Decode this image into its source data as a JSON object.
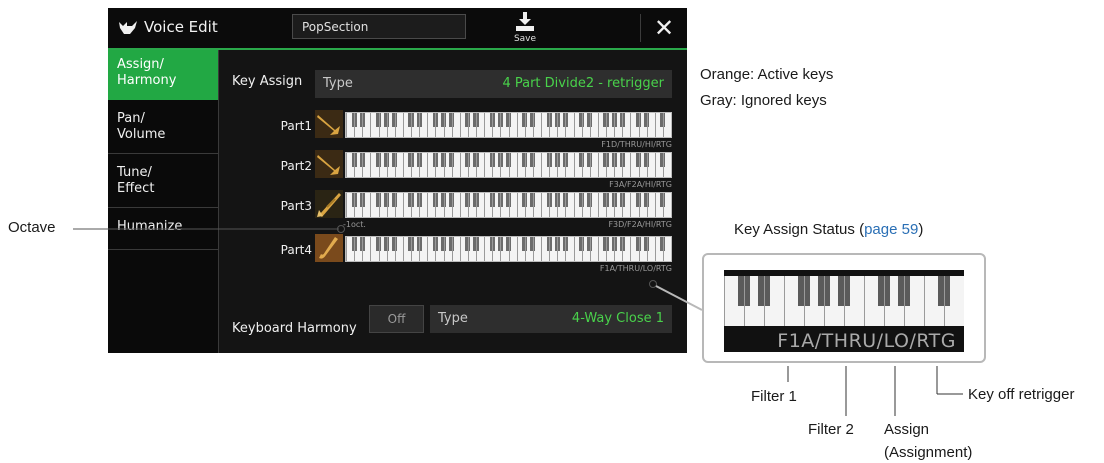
{
  "window": {
    "title": "Voice Edit",
    "app_icon": "voice-edit-icon",
    "voice_name": "PopSection",
    "save_label": "Save",
    "close_label": "✕"
  },
  "sidebar": {
    "items": [
      {
        "label": "Assign/\nHarmony",
        "active": true
      },
      {
        "label": "Pan/\nVolume",
        "active": false
      },
      {
        "label": "Tune/\nEffect",
        "active": false
      },
      {
        "label": "Humanize",
        "active": false
      }
    ]
  },
  "key_assign": {
    "label": "Key Assign",
    "type_label": "Type",
    "type_value": "4 Part Divide2 - retrigger"
  },
  "parts": [
    {
      "label": "Part1",
      "instrument_icon": "trumpet-icon",
      "status": "F1D/THRU/HI/RTG"
    },
    {
      "label": "Part2",
      "instrument_icon": "trumpet-icon",
      "status": "F3A/F2A/HI/RTG"
    },
    {
      "label": "Part3",
      "instrument_icon": "trombone-icon",
      "status": "F3D/F2A/HI/RTG",
      "octave": "-1oct."
    },
    {
      "label": "Part4",
      "instrument_icon": "saxophone-icon",
      "status": "F1A/THRU/LO/RTG"
    }
  ],
  "keyboard_harmony": {
    "label": "Keyboard Harmony",
    "toggle": "Off",
    "type_label": "Type",
    "type_value": "4-Way Close 1"
  },
  "annotations": {
    "legend_orange": "Orange: Active keys",
    "legend_gray": "Gray: Ignored keys",
    "octave": "Octave",
    "key_assign_status_title": "Key Assign Status (",
    "key_assign_status_link": "page 59",
    "key_assign_status_close": ")",
    "zoom_status": "F1A/THRU/LO/RTG",
    "filter1": "Filter 1",
    "filter2": "Filter 2",
    "assign": "Assign",
    "assignment": "(Assignment)",
    "key_off_retrigger": "Key off retrigger"
  },
  "colors": {
    "accent_green": "#22a844",
    "value_green": "#49d24b",
    "link_blue": "#2a6fb5",
    "screen_bg": "#141414"
  }
}
